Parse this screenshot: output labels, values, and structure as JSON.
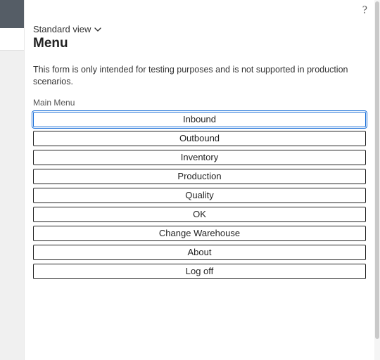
{
  "help_tooltip": "?",
  "view": {
    "label": "Standard view"
  },
  "title": "Menu",
  "description": "This form is only intended for testing purposes and is not supported in production scenarios.",
  "section_label": "Main Menu",
  "menu": {
    "items": [
      {
        "label": "Inbound"
      },
      {
        "label": "Outbound"
      },
      {
        "label": "Inventory"
      },
      {
        "label": "Production"
      },
      {
        "label": "Quality"
      },
      {
        "label": "OK"
      },
      {
        "label": "Change Warehouse"
      },
      {
        "label": "About"
      },
      {
        "label": "Log off"
      }
    ]
  }
}
